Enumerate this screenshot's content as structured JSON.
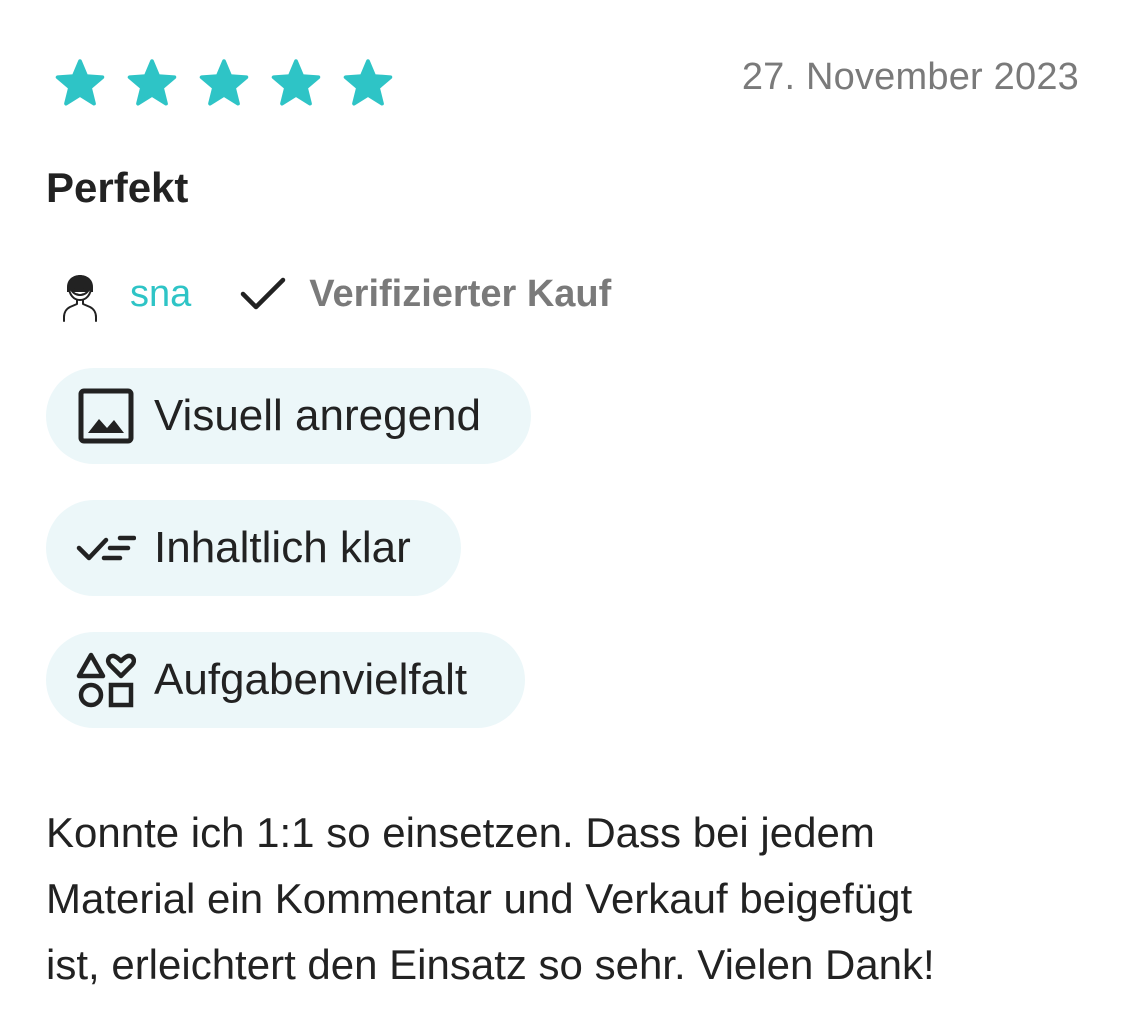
{
  "review": {
    "rating": 5,
    "max_rating": 5,
    "star_color": "#2ec4c6",
    "date": "27. November 2023",
    "title": "Perfekt",
    "author": {
      "name": "sna",
      "avatar_icon": "user-avatar-icon",
      "name_color": "#2ec4c6"
    },
    "verified": {
      "icon": "check-icon",
      "label": "Verifizierter Kauf"
    },
    "tags": [
      {
        "icon": "image-icon",
        "label": "Visuell anregend"
      },
      {
        "icon": "checklist-icon",
        "label": "Inhaltlich klar"
      },
      {
        "icon": "shapes-icon",
        "label": "Aufgabenvielfalt"
      }
    ],
    "tag_background": "#ecf7f9",
    "body_lines": [
      "Konnte ich 1:1 so einsetzen. Dass bei jedem",
      "Material ein Kommentar und Verkauf beigefügt",
      "ist, erleichtert den Einsatz so sehr. Vielen Dank!"
    ]
  }
}
